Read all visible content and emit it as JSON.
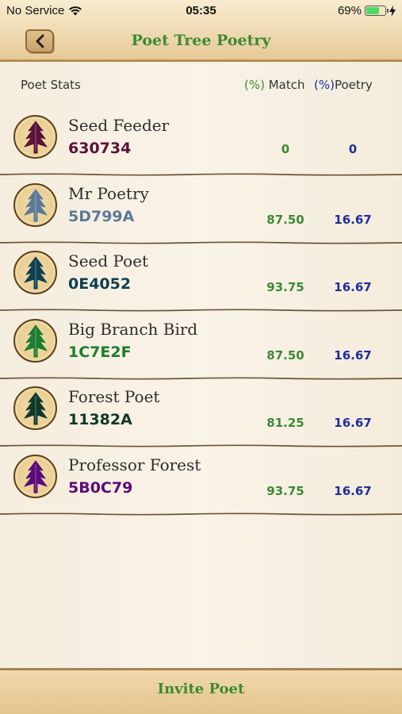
{
  "status_bar": {
    "carrier": "No Service",
    "time": "05:35",
    "battery_percent": "69%",
    "battery_level": 0.69,
    "battery_color": "#4cd964"
  },
  "header": {
    "title": "Poet Tree Poetry",
    "back_icon": "chevron-left-icon"
  },
  "table": {
    "col_poet": "Poet Stats",
    "col_match_pct": "(%)",
    "col_match": " Match",
    "col_poetry_pct": "(%)",
    "col_poetry": "Poetry",
    "rows": [
      {
        "name": "Seed Feeder",
        "code": "630734",
        "color": "#5a1238",
        "match": "0",
        "poetry": "0"
      },
      {
        "name": "Mr Poetry",
        "code": "5D799A",
        "color": "#5d799a",
        "match": "87.50",
        "poetry": "16.67"
      },
      {
        "name": "Seed Poet",
        "code": "0E4052",
        "color": "#0e4052",
        "match": "93.75",
        "poetry": "16.67"
      },
      {
        "name": "Big Branch Bird",
        "code": "1C7E2F",
        "color": "#1c7e2f",
        "match": "87.50",
        "poetry": "16.67"
      },
      {
        "name": "Forest Poet",
        "code": "11382A",
        "color": "#11382a",
        "match": "81.25",
        "poetry": "16.67"
      },
      {
        "name": "Professor Forest",
        "code": "5B0C79",
        "color": "#5b0c79",
        "match": "93.75",
        "poetry": "16.67"
      }
    ]
  },
  "footer": {
    "invite_label": "Invite Poet"
  },
  "colors": {
    "accent_green": "#3c8a34",
    "accent_blue": "#1f2e9c"
  }
}
